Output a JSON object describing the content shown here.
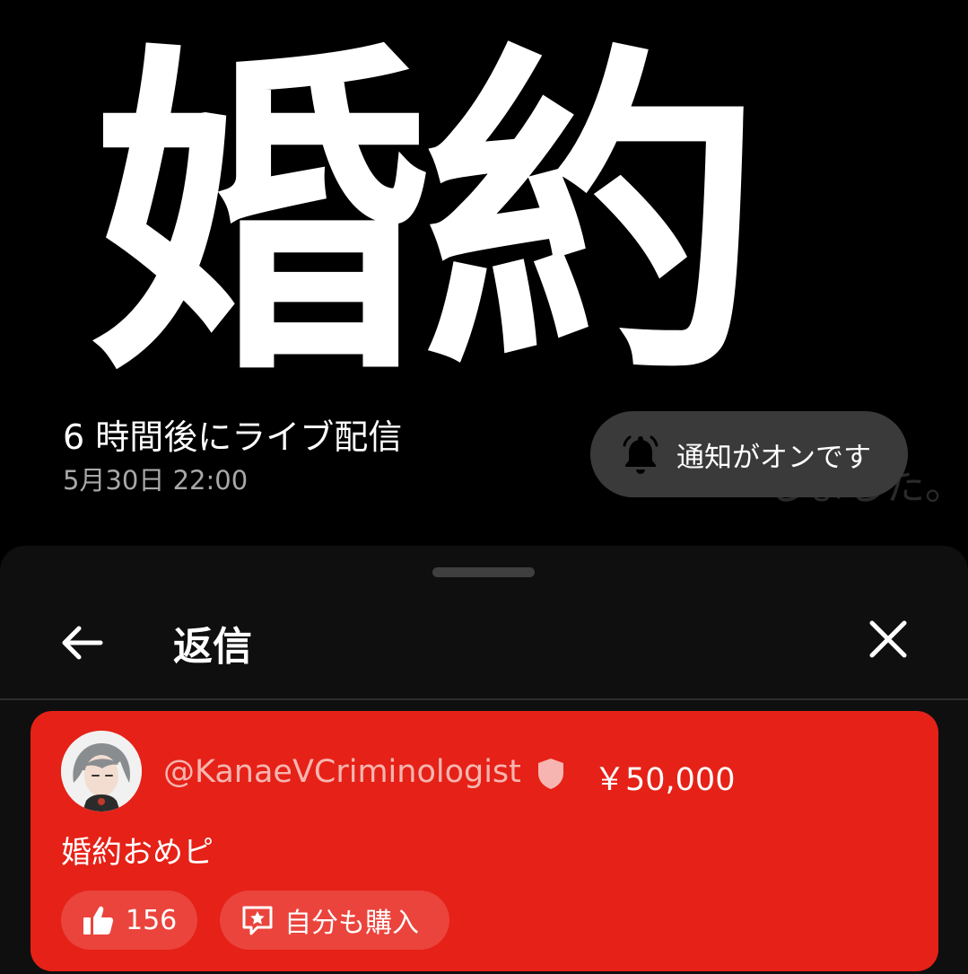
{
  "thumbnail": {
    "title_text": "婚約",
    "overlay_text": "しました。"
  },
  "live": {
    "status": "6 時間後にライブ配信",
    "schedule": "5月30日 22:00"
  },
  "notification": {
    "label": "通知がオンです",
    "icon": "bell-icon"
  },
  "sheet": {
    "title": "返信",
    "back_icon": "arrow-left-icon",
    "close_icon": "close-icon"
  },
  "superchat": {
    "username": "@KanaeVCriminologist",
    "amount": "￥50,000",
    "message": "婚約おめピ",
    "likes": "156",
    "buy_label": "自分も購入",
    "card_color": "#e62117"
  }
}
